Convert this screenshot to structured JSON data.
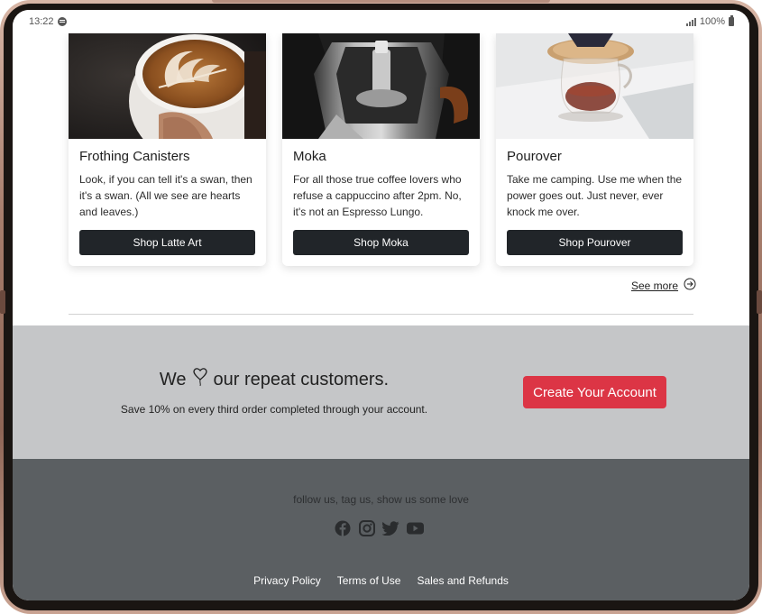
{
  "status_bar": {
    "time": "13:22",
    "battery": "100%"
  },
  "products": [
    {
      "title": "Frothing Canisters",
      "description": "Look, if you can tell it's a swan, then it's a swan. (All we see are hearts and leaves.)",
      "button": "Shop Latte Art"
    },
    {
      "title": "Moka",
      "description": "For all those true coffee lovers who refuse a cappuccino after 2pm. No, it's not an Espresso Lungo.",
      "button": "Shop Moka"
    },
    {
      "title": "Pourover",
      "description": "Take me camping. Use me when the power goes out. Just never, ever knock me over.",
      "button": "Shop Pourover"
    }
  ],
  "see_more": "See more",
  "promo": {
    "heading_before": "We",
    "heading_after": "our repeat customers.",
    "subtext": "Save 10% on every third order completed through your account.",
    "cta": "Create Your Account"
  },
  "footer": {
    "tagline": "follow us, tag us, show us some love",
    "socials": [
      "facebook-icon",
      "instagram-icon",
      "twitter-icon",
      "youtube-icon"
    ],
    "links": [
      "Privacy Policy",
      "Terms of Use",
      "Sales and Refunds"
    ]
  },
  "colors": {
    "cta": "#dc3545",
    "dark_button": "#212529",
    "promo_bg": "#c5c6c8",
    "footer_bg": "#5b5f62"
  }
}
